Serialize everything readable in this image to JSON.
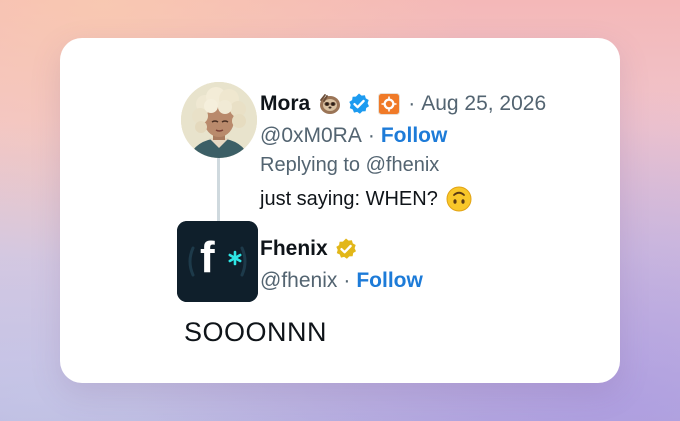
{
  "tweet": {
    "author_name": "Mora",
    "author_handle": "@0xM0RA",
    "date": "Aug 25, 2026",
    "follow_label": "Follow",
    "separator": "·",
    "replying_to": "Replying to @fhenix",
    "text": "just saying: WHEN?",
    "icons": [
      "sloth-emoji-icon",
      "verified-badge-icon",
      "org-badge-icon",
      "upside-down-face-emoji-icon"
    ]
  },
  "reply": {
    "author_name": "Fhenix",
    "author_handle": "@fhenix",
    "follow_label": "Follow",
    "separator": "·",
    "text": "SOOONNN",
    "logo_text": "f",
    "icons": [
      "gold-verified-badge-icon"
    ]
  },
  "colors": {
    "link_blue": "#1d7bd8",
    "verified_blue": "#1d9bf0",
    "gold_badge": "#e2b719",
    "org_badge": "#f07a28",
    "logo_bg": "#0f1f2b",
    "logo_accent": "#2ee6e6"
  }
}
